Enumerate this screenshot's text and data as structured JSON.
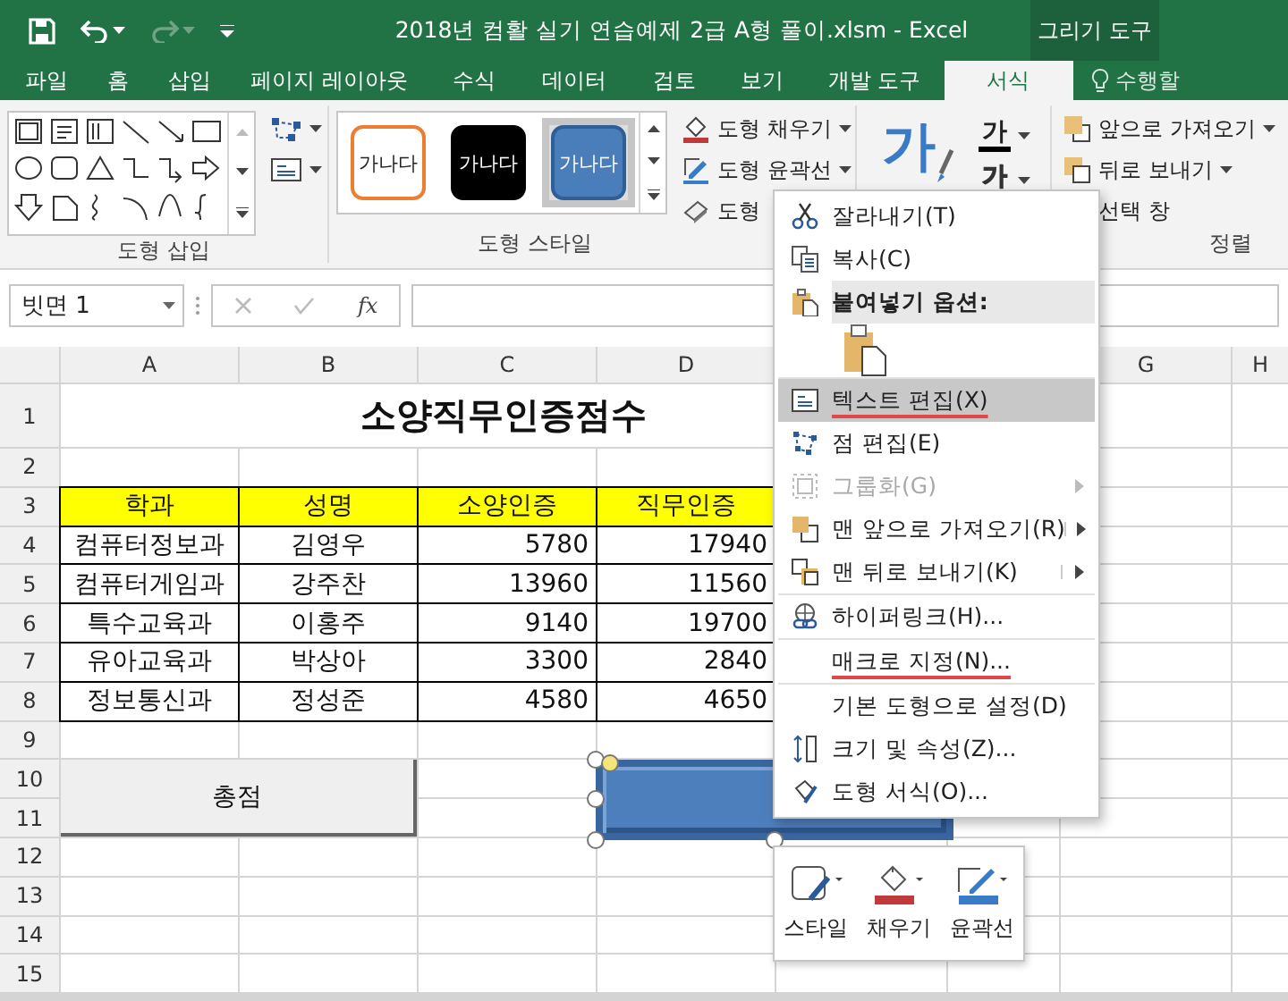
{
  "title_bar": {
    "title": "2018년 컴활 실기 연습예제 2급 A형 풀이.xlsm - Excel",
    "context_group": "그리기 도구"
  },
  "ribbon_tabs": [
    {
      "label": "파일",
      "selected": false
    },
    {
      "label": "홈",
      "selected": false
    },
    {
      "label": "삽입",
      "selected": false
    },
    {
      "label": "페이지 레이아웃",
      "selected": false
    },
    {
      "label": "수식",
      "selected": false
    },
    {
      "label": "데이터",
      "selected": false
    },
    {
      "label": "검토",
      "selected": false
    },
    {
      "label": "보기",
      "selected": false
    },
    {
      "label": "개발 도구",
      "selected": false
    },
    {
      "label": "서식",
      "selected": true
    }
  ],
  "tell_me": "수행할",
  "ribbon": {
    "shape_insert": {
      "label": "도형 삽입"
    },
    "shape_styles": {
      "label": "도형 스타일",
      "presets": [
        {
          "text": "가나다",
          "kind": "outline",
          "selected": false
        },
        {
          "text": "가나다",
          "kind": "dark",
          "selected": false
        },
        {
          "text": "가나다",
          "kind": "filled",
          "selected": true
        }
      ],
      "commands": [
        "도형 채우기",
        "도형 윤곽선",
        "도형"
      ]
    },
    "wordart": {
      "quick_style": "가",
      "text_fill": "가",
      "text_outline": "가"
    },
    "arrange": {
      "label": "정렬",
      "commands": [
        "앞으로 가져오기",
        "뒤로 보내기",
        "선택 창"
      ]
    }
  },
  "formula_bar": {
    "name_box": "빗면 1",
    "function_label": "fx"
  },
  "sheet": {
    "column_headers": [
      "A",
      "B",
      "C",
      "D",
      "G",
      "H"
    ],
    "row_numbers": [
      "1",
      "2",
      "3",
      "4",
      "5",
      "6",
      "7",
      "8",
      "9",
      "10",
      "11",
      "12",
      "13",
      "14",
      "15"
    ],
    "title": "소양직무인증점수",
    "table": {
      "columns": [
        "학과",
        "성명",
        "소양인증",
        "직무인증"
      ],
      "rows": [
        [
          "컴퓨터정보과",
          "김영우",
          "5780",
          "17940"
        ],
        [
          "컴퓨터게임과",
          "강주찬",
          "13960",
          "11560"
        ],
        [
          "특수교육과",
          "이홍주",
          "9140",
          "19700"
        ],
        [
          "유아교육과",
          "박상아",
          "3300",
          "2840"
        ],
        [
          "정보통신과",
          "정성준",
          "4580",
          "4650"
        ]
      ]
    },
    "total_label": "총점"
  },
  "context_menu": {
    "items": [
      {
        "kind": "command",
        "label": "잘라내기(T)",
        "selected": false,
        "disabled": false,
        "submenu": false,
        "annotated": false,
        "divider_above": false
      },
      {
        "kind": "command",
        "label": "복사(C)",
        "selected": false,
        "disabled": false,
        "submenu": false,
        "annotated": false,
        "divider_above": false
      },
      {
        "kind": "section_header",
        "label": "붙여넣기 옵션:",
        "selected": false
      },
      {
        "kind": "paste_option",
        "selected": false
      },
      {
        "kind": "command",
        "label": "텍스트 편집(X)",
        "selected": true,
        "disabled": false,
        "submenu": false,
        "annotated": true,
        "divider_above": true
      },
      {
        "kind": "command",
        "label": "점 편집(E)",
        "selected": false,
        "disabled": false,
        "submenu": false,
        "annotated": false,
        "divider_above": false
      },
      {
        "kind": "command",
        "label": "그룹화(G)",
        "selected": false,
        "disabled": true,
        "submenu": true,
        "annotated": false,
        "divider_above": false
      },
      {
        "kind": "command",
        "label": "맨 앞으로 가져오기(R)",
        "selected": false,
        "disabled": false,
        "submenu": true,
        "annotated": false,
        "divider_above": false
      },
      {
        "kind": "command",
        "label": "맨 뒤로 보내기(K)",
        "selected": false,
        "disabled": false,
        "submenu": true,
        "annotated": false,
        "divider_above": false
      },
      {
        "kind": "command",
        "label": "하이퍼링크(H)...",
        "selected": false,
        "disabled": false,
        "submenu": false,
        "annotated": false,
        "divider_above": true
      },
      {
        "kind": "command",
        "label": "매크로 지정(N)...",
        "selected": false,
        "disabled": false,
        "submenu": false,
        "annotated": true,
        "divider_above": true
      },
      {
        "kind": "command",
        "label": "기본 도형으로 설정(D)",
        "selected": false,
        "disabled": false,
        "submenu": false,
        "annotated": false,
        "divider_above": true
      },
      {
        "kind": "command",
        "label": "크기 및 속성(Z)...",
        "selected": false,
        "disabled": false,
        "submenu": false,
        "annotated": false,
        "divider_above": false
      },
      {
        "kind": "command",
        "label": "도형 서식(O)...",
        "selected": false,
        "disabled": false,
        "submenu": false,
        "annotated": false,
        "divider_above": false
      }
    ]
  },
  "mini_toolbar": {
    "buttons": [
      {
        "label": "스타일"
      },
      {
        "label": "채우기"
      },
      {
        "label": "윤곽선"
      }
    ]
  }
}
